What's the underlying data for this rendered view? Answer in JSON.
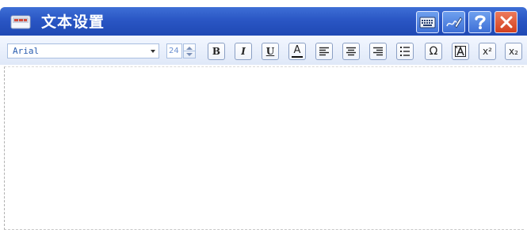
{
  "window": {
    "title": "文本设置"
  },
  "title_buttons": [
    {
      "name": "keyboard-button",
      "icon": "keyboard-icon"
    },
    {
      "name": "handwriting-button",
      "icon": "handwriting-pen-icon"
    },
    {
      "name": "help-button",
      "icon": "question-mark-icon",
      "glyph": "?"
    },
    {
      "name": "close-button",
      "icon": "close-icon"
    }
  ],
  "toolbar": {
    "font_family": "Arial",
    "font_size": "24",
    "bold_label": "B",
    "italic_label": "I",
    "underline_label": "U",
    "font_color_label": "A",
    "special_char_label": "Ω",
    "superscript_label": "x²",
    "subscript_label": "x₂"
  },
  "colors": {
    "title_bar": "#2a56c4",
    "toolbar_bg": "#e6edf9",
    "close_button": "#d3401e",
    "font_text": "#2a5db0"
  }
}
